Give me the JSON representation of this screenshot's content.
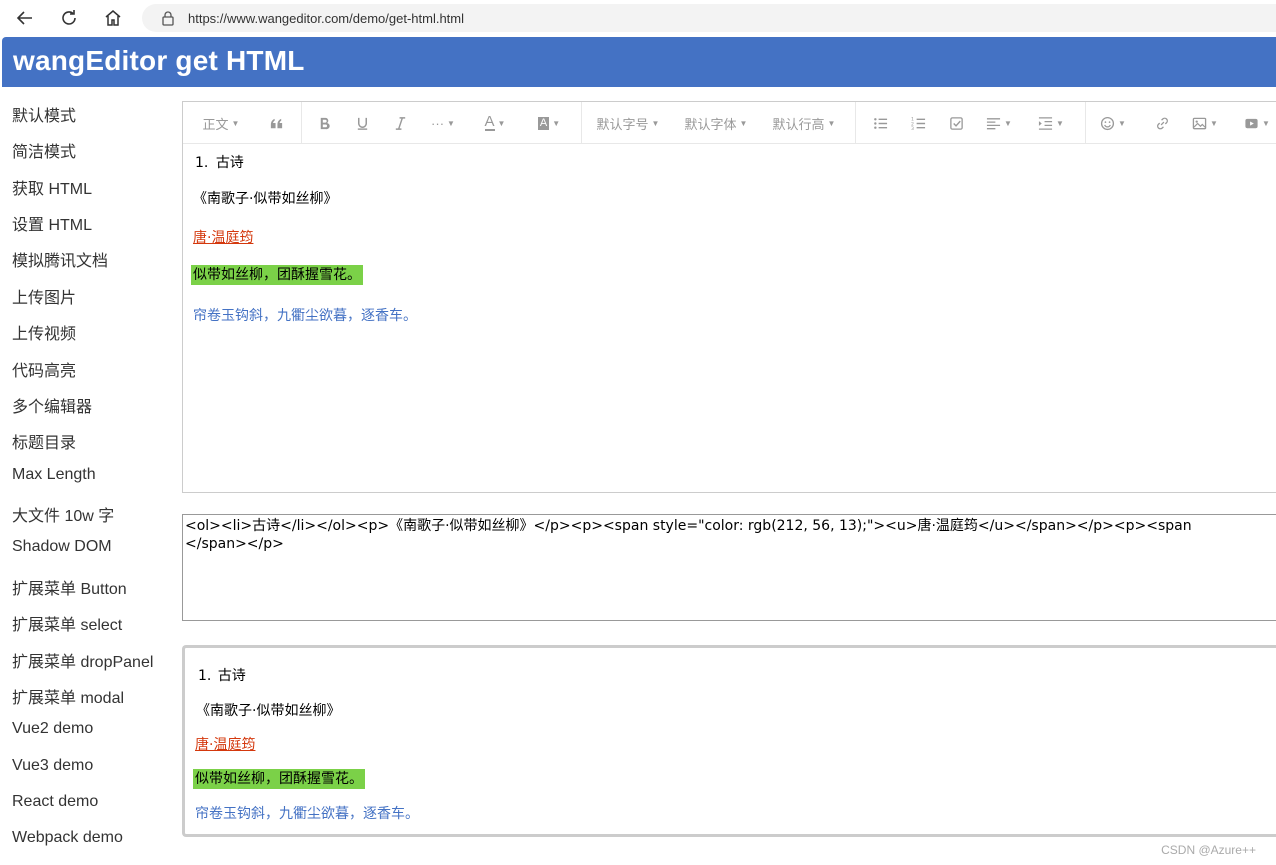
{
  "browser": {
    "url": "https://www.wangeditor.com/demo/get-html.html",
    "back_icon": "arrow-left",
    "reload_icon": "reload",
    "home_icon": "home",
    "lock_icon": "lock"
  },
  "header": {
    "title": "wangEditor get HTML",
    "bg": "#4472c4"
  },
  "sidebar": {
    "items": [
      {
        "label": "默认模式"
      },
      {
        "label": "简洁模式"
      },
      {
        "label": "获取 HTML"
      },
      {
        "label": "设置 HTML"
      },
      {
        "label": "模拟腾讯文档"
      },
      {
        "label": "上传图片"
      },
      {
        "label": "上传视频"
      },
      {
        "label": "代码高亮"
      },
      {
        "label": "多个编辑器"
      },
      {
        "label": "标题目录"
      },
      {
        "label": "Max Length"
      },
      {
        "label": "大文件 10w 字"
      },
      {
        "label": "Shadow DOM"
      },
      {
        "label": "扩展菜单 Button"
      },
      {
        "label": "扩展菜单 select"
      },
      {
        "label": "扩展菜单 dropPanel"
      },
      {
        "label": "扩展菜单 modal"
      },
      {
        "label": "Vue2 demo"
      },
      {
        "label": "Vue3 demo"
      },
      {
        "label": "React demo"
      },
      {
        "label": "Webpack demo"
      }
    ]
  },
  "toolbar": {
    "header_select": "正文",
    "font_size": "默认字号",
    "font_family": "默认字体",
    "line_height": "默认行高",
    "more": "···",
    "font_color": "A",
    "bg_color": "A"
  },
  "document": {
    "list_number": "1.",
    "list_item": "古诗",
    "title": "《南歌子·似带如丝柳》",
    "author": "唐·温庭筠",
    "line1": "似带如丝柳，团酥握雪花。",
    "line2": "帘卷玉钩斜，九衢尘欲暮，逐香车。"
  },
  "colors": {
    "author": "#d4380d",
    "highlight": "#7bd148",
    "line2": "#4472c4"
  },
  "html_output": "<ol><li>古诗</li></ol><p>《南歌子·似带如丝柳》</p><p><span style=\"color: rgb(212, 56, 13);\"><u>唐·温庭筠</u></span></p><p><span \n</span></p>",
  "watermark": "CSDN @Azure++"
}
